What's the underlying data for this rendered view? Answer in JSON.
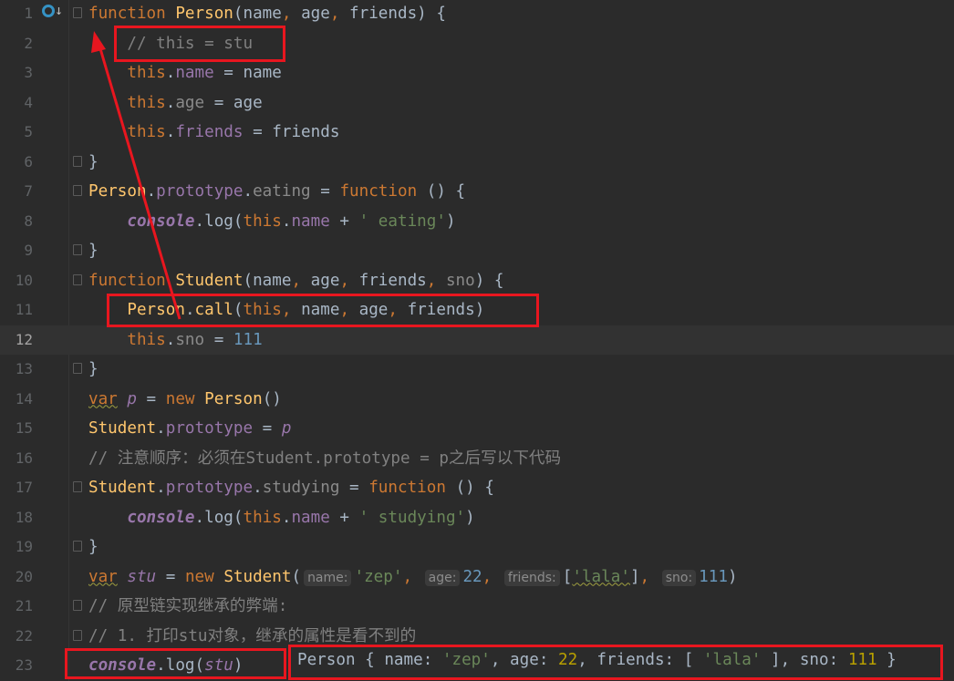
{
  "editor": {
    "current_line": 12,
    "lines": [
      {
        "n": "1",
        "fold": true,
        "icons": true,
        "tokens": [
          [
            "kw",
            "function "
          ],
          [
            "fn",
            "Person"
          ],
          [
            "txt",
            "(name"
          ],
          [
            "kw",
            ", "
          ],
          [
            "txt",
            "age"
          ],
          [
            "kw",
            ", "
          ],
          [
            "txt",
            "friends) {"
          ]
        ]
      },
      {
        "n": "2",
        "tokens": [
          [
            "txt",
            "    "
          ],
          [
            "cm",
            "// this = stu"
          ]
        ]
      },
      {
        "n": "3",
        "tokens": [
          [
            "txt",
            "    "
          ],
          [
            "kw",
            "this"
          ],
          [
            "txt",
            "."
          ],
          [
            "prop",
            "name"
          ],
          [
            "txt",
            " = name"
          ]
        ]
      },
      {
        "n": "4",
        "tokens": [
          [
            "txt",
            "    "
          ],
          [
            "kw",
            "this"
          ],
          [
            "txt",
            "."
          ],
          [
            "pgray",
            "age"
          ],
          [
            "txt",
            " = age"
          ]
        ]
      },
      {
        "n": "5",
        "tokens": [
          [
            "txt",
            "    "
          ],
          [
            "kw",
            "this"
          ],
          [
            "txt",
            "."
          ],
          [
            "prop",
            "friends"
          ],
          [
            "txt",
            " = friends"
          ]
        ]
      },
      {
        "n": "6",
        "fold": true,
        "tokens": [
          [
            "txt",
            "}"
          ]
        ]
      },
      {
        "n": "7",
        "fold": true,
        "tokens": [
          [
            "fn",
            "Person"
          ],
          [
            "txt",
            "."
          ],
          [
            "prop",
            "prototype"
          ],
          [
            "txt",
            "."
          ],
          [
            "pgray",
            "eating"
          ],
          [
            "txt",
            " = "
          ],
          [
            "kw",
            "function "
          ],
          [
            "txt",
            "() {"
          ]
        ]
      },
      {
        "n": "8",
        "tokens": [
          [
            "txt",
            "    "
          ],
          [
            "ital",
            "console"
          ],
          [
            "txt",
            ".log("
          ],
          [
            "kw",
            "this"
          ],
          [
            "txt",
            "."
          ],
          [
            "prop",
            "name"
          ],
          [
            "txt",
            " + "
          ],
          [
            "str",
            "' eating'"
          ],
          [
            "txt",
            ")"
          ]
        ]
      },
      {
        "n": "9",
        "fold": true,
        "tokens": [
          [
            "txt",
            "}"
          ]
        ]
      },
      {
        "n": "10",
        "fold": true,
        "tokens": [
          [
            "kw",
            "function "
          ],
          [
            "fn",
            "Student"
          ],
          [
            "txt",
            "(name"
          ],
          [
            "kw",
            ", "
          ],
          [
            "txt",
            "age"
          ],
          [
            "kw",
            ", "
          ],
          [
            "txt",
            "friends"
          ],
          [
            "kw",
            ", "
          ],
          [
            "pgray",
            "sno"
          ],
          [
            "txt",
            ") {"
          ]
        ]
      },
      {
        "n": "11",
        "tokens": [
          [
            "txt",
            "    "
          ],
          [
            "fn",
            "Person"
          ],
          [
            "txt",
            "."
          ],
          [
            "call",
            "call"
          ],
          [
            "txt",
            "("
          ],
          [
            "kw",
            "this, "
          ],
          [
            "txt",
            "name"
          ],
          [
            "kw",
            ", "
          ],
          [
            "txt",
            "age"
          ],
          [
            "kw",
            ", "
          ],
          [
            "txt",
            "friends)"
          ]
        ]
      },
      {
        "n": "12",
        "tokens": [
          [
            "txt",
            "    "
          ],
          [
            "kw",
            "this"
          ],
          [
            "txt",
            "."
          ],
          [
            "pgray",
            "sno"
          ],
          [
            "txt",
            " = "
          ],
          [
            "num",
            "111"
          ]
        ]
      },
      {
        "n": "13",
        "fold": true,
        "tokens": [
          [
            "txt",
            "}"
          ]
        ]
      },
      {
        "n": "14",
        "tokens": [
          [
            "kwsq",
            "var"
          ],
          [
            "txt",
            " "
          ],
          [
            "var",
            "p"
          ],
          [
            "txt",
            " = "
          ],
          [
            "kw",
            "new "
          ],
          [
            "fn",
            "Person"
          ],
          [
            "txt",
            "()"
          ]
        ]
      },
      {
        "n": "15",
        "tokens": [
          [
            "fn",
            "Student"
          ],
          [
            "txt",
            "."
          ],
          [
            "prop",
            "prototype"
          ],
          [
            "txt",
            " = "
          ],
          [
            "var",
            "p"
          ]
        ]
      },
      {
        "n": "16",
        "tokens": [
          [
            "cm",
            "// 注意顺序：必须在Student.prototype = p之后写以下代码"
          ]
        ]
      },
      {
        "n": "17",
        "fold": true,
        "tokens": [
          [
            "fn",
            "Student"
          ],
          [
            "txt",
            "."
          ],
          [
            "prop",
            "prototype"
          ],
          [
            "txt",
            "."
          ],
          [
            "pgray",
            "studying"
          ],
          [
            "txt",
            " = "
          ],
          [
            "kw",
            "function "
          ],
          [
            "txt",
            "() {"
          ]
        ]
      },
      {
        "n": "18",
        "tokens": [
          [
            "txt",
            "    "
          ],
          [
            "ital",
            "console"
          ],
          [
            "txt",
            ".log("
          ],
          [
            "kw",
            "this"
          ],
          [
            "txt",
            "."
          ],
          [
            "prop",
            "name"
          ],
          [
            "txt",
            " + "
          ],
          [
            "str",
            "' studying'"
          ],
          [
            "txt",
            ")"
          ]
        ]
      },
      {
        "n": "19",
        "fold": true,
        "tokens": [
          [
            "txt",
            "}"
          ]
        ]
      },
      {
        "n": "20",
        "tokens": [
          [
            "kwsq",
            "var"
          ],
          [
            "txt",
            " "
          ],
          [
            "var",
            "stu"
          ],
          [
            "txt",
            " = "
          ],
          [
            "kw",
            "new "
          ],
          [
            "fn",
            "Student"
          ],
          [
            "txt",
            "("
          ],
          [
            "hint",
            "name:"
          ],
          [
            "str",
            "'zep'"
          ],
          [
            "kw",
            ", "
          ],
          [
            "hint",
            "age:"
          ],
          [
            "num",
            "22"
          ],
          [
            "kw",
            ", "
          ],
          [
            "hint",
            "friends:"
          ],
          [
            "txt",
            "["
          ],
          [
            "strsq",
            "'lala'"
          ],
          [
            "txt",
            "]"
          ],
          [
            "kw",
            ", "
          ],
          [
            "hint",
            "sno:"
          ],
          [
            "num",
            "111"
          ],
          [
            "txt",
            ")"
          ]
        ]
      },
      {
        "n": "21",
        "fold": true,
        "tokens": [
          [
            "cm",
            "// 原型链实现继承的弊端:"
          ]
        ]
      },
      {
        "n": "22",
        "fold": true,
        "tokens": [
          [
            "cm",
            "// 1. 打印stu对象，继承的属性是看不到的"
          ]
        ]
      },
      {
        "n": "23",
        "tokens": [
          [
            "ital",
            "console"
          ],
          [
            "txt",
            ".log("
          ],
          [
            "var",
            "stu"
          ],
          [
            "txt",
            ")"
          ]
        ]
      }
    ]
  },
  "output": {
    "tokens": [
      [
        "t",
        "Person { name: "
      ],
      [
        "s",
        "'zep'"
      ],
      [
        "t",
        ", age: "
      ],
      [
        "n",
        "22"
      ],
      [
        "t",
        ", friends: [ "
      ],
      [
        "s",
        "'lala'"
      ],
      [
        "t",
        " ], sno: "
      ],
      [
        "n",
        "111"
      ],
      [
        "t",
        " }"
      ]
    ]
  },
  "annotation_color": "#e8161f"
}
